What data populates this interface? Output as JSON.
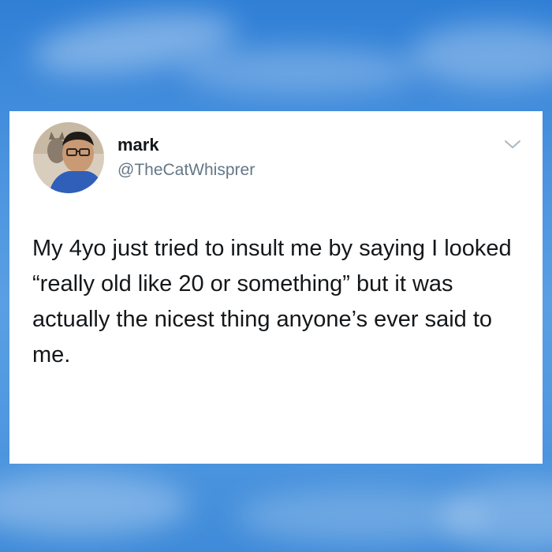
{
  "tweet": {
    "display_name": "mark",
    "handle": "@TheCatWhisprer",
    "text": "My 4yo just tried to insult me by saying I looked “really old like 20 or something” but it was actually the nicest thing anyone’s ever said to me.",
    "avatar_icon": "profile-photo",
    "menu_icon": "chevron-down-icon"
  },
  "colors": {
    "sky": "#4b93df",
    "card": "#ffffff",
    "name_text": "#14171a",
    "handle_text": "#657786",
    "chevron": "#aab8c2"
  }
}
